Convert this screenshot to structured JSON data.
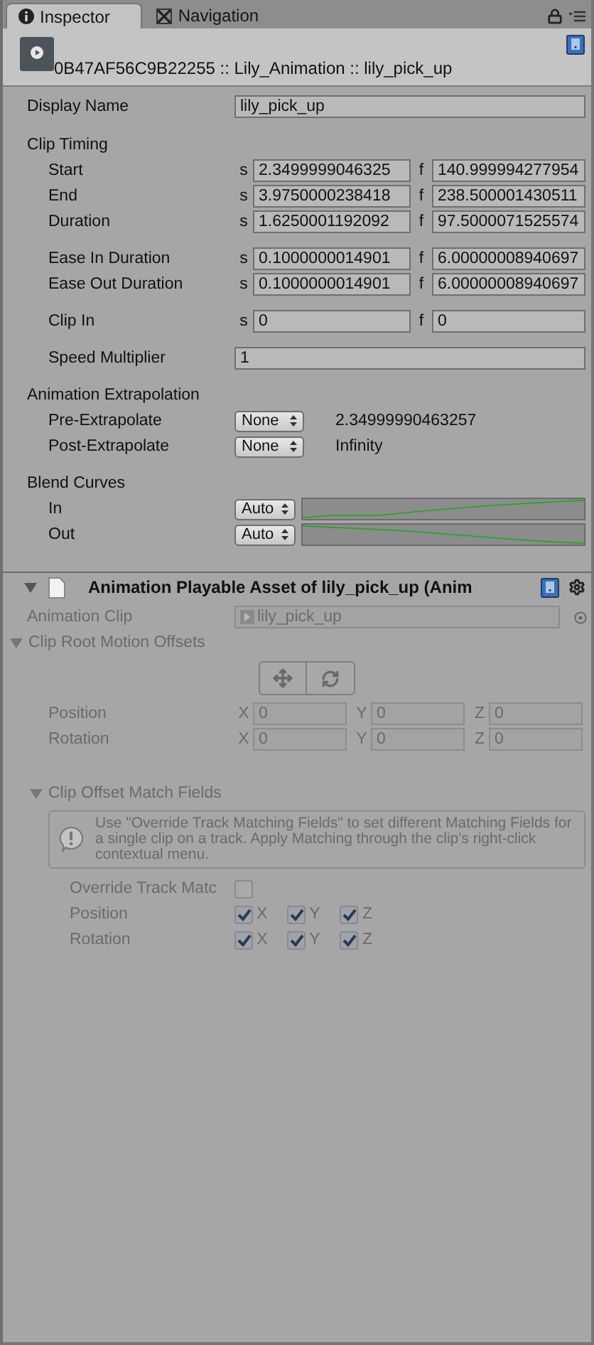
{
  "tabs": [
    {
      "label": "Inspector",
      "selected": true
    },
    {
      "label": "Navigation",
      "selected": false
    }
  ],
  "header": {
    "title": "0B47AF56C9B22255 :: Lily_Animation :: lily_pick_up"
  },
  "display_name": {
    "label": "Display Name",
    "value": "lily_pick_up"
  },
  "clip_timing": {
    "title": "Clip Timing",
    "groups": [
      [
        {
          "label": "Start",
          "s_label": "s",
          "s": "2.3499999046325",
          "f_label": "f",
          "f": "140.999994277954"
        },
        {
          "label": "End",
          "s_label": "s",
          "s": "3.9750000238418",
          "f_label": "f",
          "f": "238.500001430511"
        },
        {
          "label": "Duration",
          "s_label": "s",
          "s": "1.6250001192092",
          "f_label": "f",
          "f": "97.5000071525574"
        }
      ],
      [
        {
          "label": "Ease In Duration",
          "s_label": "s",
          "s": "0.1000000014901",
          "f_label": "f",
          "f": "6.00000008940697"
        },
        {
          "label": "Ease Out Duration",
          "s_label": "s",
          "s": "0.1000000014901",
          "f_label": "f",
          "f": "6.00000008940697"
        }
      ],
      [
        {
          "label": "Clip In",
          "s_label": "s",
          "s": "0",
          "f_label": "f",
          "f": "0"
        }
      ]
    ]
  },
  "speed_multiplier": {
    "label": "Speed Multiplier",
    "value": "1"
  },
  "extrapolation": {
    "title": "Animation Extrapolation",
    "rows": [
      {
        "label": "Pre-Extrapolate",
        "option": "None",
        "value": "2.34999990463257"
      },
      {
        "label": "Post-Extrapolate",
        "option": "None",
        "value": "Infinity"
      }
    ]
  },
  "blend_curves": {
    "title": "Blend Curves",
    "rows": [
      {
        "label": "In",
        "option": "Auto",
        "kind": "ease_in"
      },
      {
        "label": "Out",
        "option": "Auto",
        "kind": "ease_out"
      }
    ]
  },
  "asset": {
    "title": "Animation Playable Asset of lily_pick_up (Anim",
    "expanded": true,
    "disabled": true,
    "clip": {
      "label": "Animation Clip",
      "value": "lily_pick_up"
    },
    "root_motion": {
      "title": "Clip Root Motion Offsets",
      "expanded": true,
      "rows": [
        {
          "label": "Position",
          "values": [
            {
              "axis": "X",
              "value": "0"
            },
            {
              "axis": "Y",
              "value": "0"
            },
            {
              "axis": "Z",
              "value": "0"
            }
          ]
        },
        {
          "label": "Rotation",
          "values": [
            {
              "axis": "X",
              "value": "0"
            },
            {
              "axis": "Y",
              "value": "0"
            },
            {
              "axis": "Z",
              "value": "0"
            }
          ]
        }
      ]
    },
    "match_fields": {
      "title": "Clip Offset Match Fields",
      "expanded": true,
      "help": "Use \"Override Track Matching Fields\" to set different Matching Fields for a single clip on a track. Apply Matching through the clip's right-click contextual menu.",
      "override": {
        "label": "Override Track Matc",
        "checked": false
      },
      "rows": [
        {
          "label": "Position",
          "checks": [
            {
              "axis": "X",
              "checked": true
            },
            {
              "axis": "Y",
              "checked": true
            },
            {
              "axis": "Z",
              "checked": true
            }
          ]
        },
        {
          "label": "Rotation",
          "checks": [
            {
              "axis": "X",
              "checked": true
            },
            {
              "axis": "Y",
              "checked": true
            },
            {
              "axis": "Z",
              "checked": true
            }
          ]
        }
      ]
    }
  }
}
